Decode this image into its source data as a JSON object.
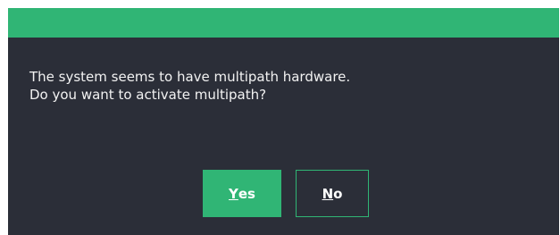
{
  "dialog": {
    "title": "",
    "message_lines": [
      "The system seems to have multipath hardware.",
      "Do you want to activate multipath?"
    ]
  },
  "buttons": {
    "yes": {
      "accel": "Y",
      "rest": "es",
      "label": "Yes"
    },
    "no": {
      "accel": "N",
      "rest": "o",
      "label": "No"
    }
  },
  "colors": {
    "accent": "#30b575",
    "background": "#2b2e38",
    "text": "#f2f2f2"
  }
}
